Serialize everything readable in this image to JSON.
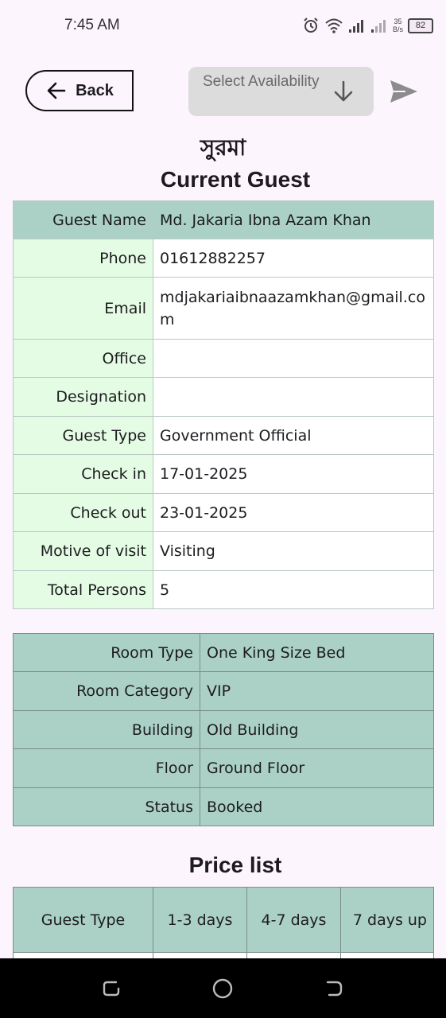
{
  "status_bar": {
    "time": "7:45 AM",
    "net_speed_value": "35",
    "net_speed_unit": "B/s",
    "battery": "82"
  },
  "toolbar": {
    "back_label": "Back",
    "select_placeholder": "Select Availability"
  },
  "header": {
    "room_name": "সুরমা",
    "title": "Current Guest"
  },
  "guest_table": [
    {
      "label": "Guest Name",
      "value": "Md. Jakaria Ibna Azam Khan"
    },
    {
      "label": "Phone",
      "value": "01612882257"
    },
    {
      "label": "Email",
      "value": "mdjakariaibnaazamkhan@gmail.com"
    },
    {
      "label": "Office",
      "value": ""
    },
    {
      "label": "Designation",
      "value": ""
    },
    {
      "label": "Guest Type",
      "value": "Government Official"
    },
    {
      "label": "Check in",
      "value": "17-01-2025"
    },
    {
      "label": "Check out",
      "value": "23-01-2025"
    },
    {
      "label": "Motive of visit",
      "value": "Visiting"
    },
    {
      "label": "Total Persons",
      "value": "5"
    }
  ],
  "room_table": [
    {
      "label": "Room Type",
      "value": "One King Size Bed"
    },
    {
      "label": "Room Category",
      "value": "VIP"
    },
    {
      "label": "Building",
      "value": "Old Building"
    },
    {
      "label": "Floor",
      "value": "Ground Floor"
    },
    {
      "label": "Status",
      "value": "Booked"
    }
  ],
  "price_list": {
    "title": "Price list",
    "headers": [
      "Guest Type",
      "1-3 days",
      "4-7 days",
      "7 days up"
    ]
  }
}
